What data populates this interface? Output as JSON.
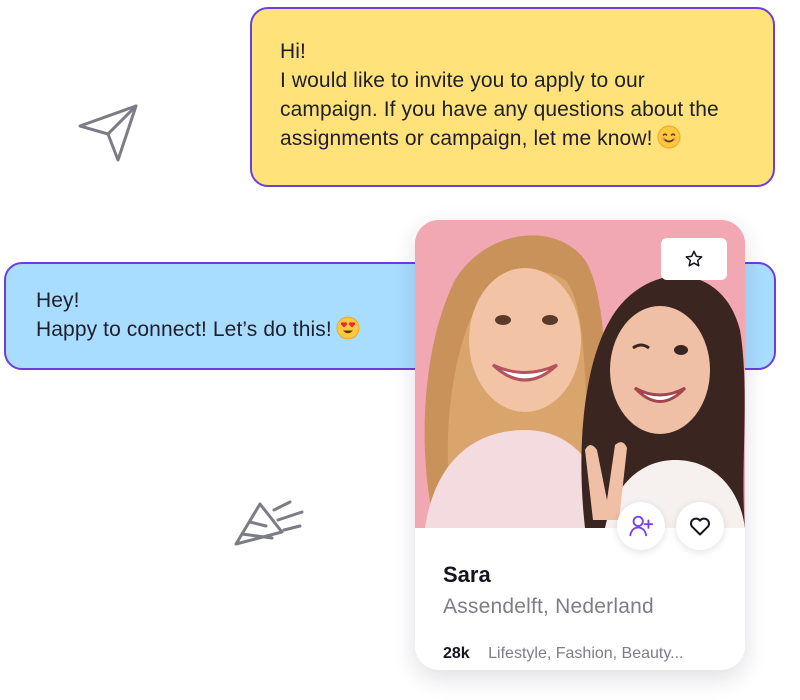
{
  "messages": {
    "invite": {
      "greeting": "Hi!",
      "line1": "I would like to invite you to apply to our",
      "line2": "campaign. If you have any questions about the",
      "line3": "assignments or campaign, let me know!",
      "emoji": "smiling-face-emoji",
      "background": "#ffe27a"
    },
    "reply": {
      "greeting": "Hey!",
      "line1": "Happy to connect! Let’s do this!",
      "emoji": "heart-eyes-emoji",
      "background": "#a9ddff"
    },
    "border_color": "#6a3ee0"
  },
  "card": {
    "name": "Sara",
    "location": "Assendelft, Nederland",
    "followers": "28k",
    "categories": "Lifestyle, Fashion, Beauty...",
    "icons": {
      "favorite": "star-icon",
      "add": "add-user-icon",
      "like": "heart-icon"
    },
    "accent": "#7a3ee6"
  },
  "decorations": {
    "top_left": "paper-plane-icon",
    "bottom_left": "party-popper-icon"
  }
}
